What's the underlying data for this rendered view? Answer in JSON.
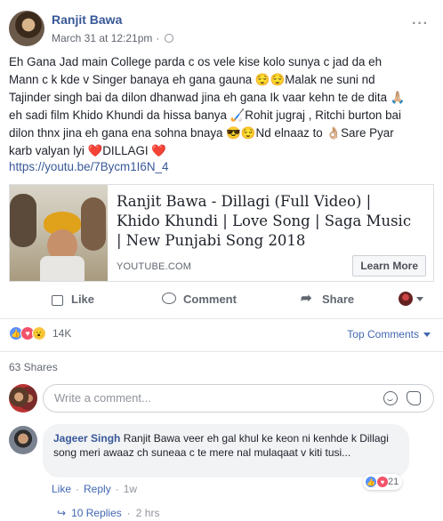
{
  "post": {
    "author": "Ranjit Bawa",
    "timestamp": "March 31 at 12:21pm",
    "separator": "·",
    "privacy_icon": "globe-icon",
    "more_icon": "more-icon",
    "text_lines": [
      "Eh Gana Jad main College parda c os vele kise kolo sunya c jad da eh",
      "Mann c k kde v Singer banaya eh gana gauna 😌😌Malak ne suni nd",
      "Tajinder singh bai da dilon dhanwad jina eh gana Ik vaar kehn te de dita 🙏🏼",
      "eh sadi film Khido Khundi da hissa banya 🏑Rohit jugraj , Ritchi burton bai",
      "dilon thnx jina eh gana ena sohna bnaya 😎😌Nd elnaaz to 👌🏼Sare Pyar",
      "karb valyan lyi ❤️DILLAGI ❤️"
    ],
    "link": "https://youtu.be/7Bycm1I6N_4"
  },
  "card": {
    "title": "Ranjit Bawa - Dillagi (Full Video) | Khido Khundi | Love Song | Saga Music | New Punjabi Song 2018",
    "domain": "YOUTUBE.COM",
    "button": "Learn More"
  },
  "actions": {
    "like": "Like",
    "comment": "Comment",
    "share": "Share"
  },
  "reactions": {
    "count": "14K",
    "top_comments": "Top Comments",
    "types": [
      "like",
      "love",
      "wow"
    ]
  },
  "shares": "63 Shares",
  "composer": {
    "placeholder": "Write a comment..."
  },
  "comment": {
    "author": "Jageer Singh",
    "text": "Ranjit Bawa veer eh gal khul ke keon ni kenhde k Dillagi song meri awaaz ch suneaa c te mere nal mulaqaat v kiti tusi...",
    "like": "Like",
    "reply": "Reply",
    "dot": "·",
    "time": "1w",
    "reaction_count": "21"
  },
  "replies": {
    "label": "10 Replies",
    "time": "2 hrs",
    "dot": "·"
  },
  "colors": {
    "link": "#385898",
    "accent": "#4267b2",
    "muted": "#616770",
    "like": "#5890ff",
    "love": "#f25268"
  }
}
